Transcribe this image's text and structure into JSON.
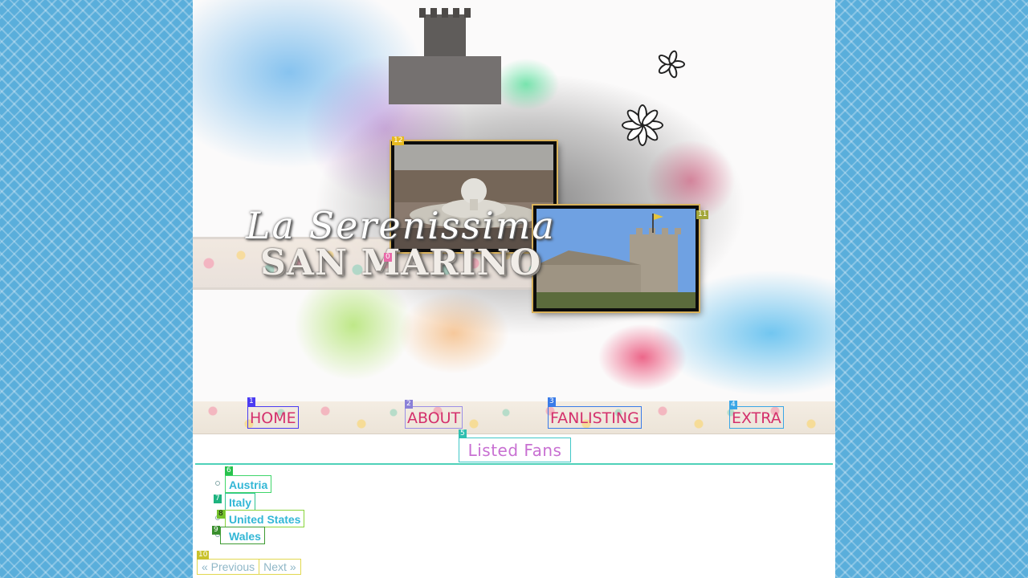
{
  "header": {
    "title_script": "La Serenissima",
    "title_main": "SAN MARINO"
  },
  "nav": {
    "items": [
      {
        "label": "HOME"
      },
      {
        "label": "ABOUT"
      },
      {
        "label": "FANLISTING"
      },
      {
        "label": "EXTRA"
      }
    ]
  },
  "content": {
    "heading": "Listed Fans",
    "countries": [
      {
        "label": "Austria"
      },
      {
        "label": "Italy"
      },
      {
        "label": "United States"
      },
      {
        "label": "Wales"
      }
    ]
  },
  "pager": {
    "previous_label": "« Previous",
    "next_label": "Next »"
  },
  "tags": [
    "0",
    "1",
    "2",
    "3",
    "4",
    "5",
    "6",
    "7",
    "8",
    "9",
    "10",
    "11",
    "12"
  ],
  "colors": {
    "page_background": "#5aaedb",
    "nav_text": "#d4306c",
    "heading_text": "#c870d2",
    "link_text": "#33b7d6",
    "rule": "#4fd1b9"
  }
}
